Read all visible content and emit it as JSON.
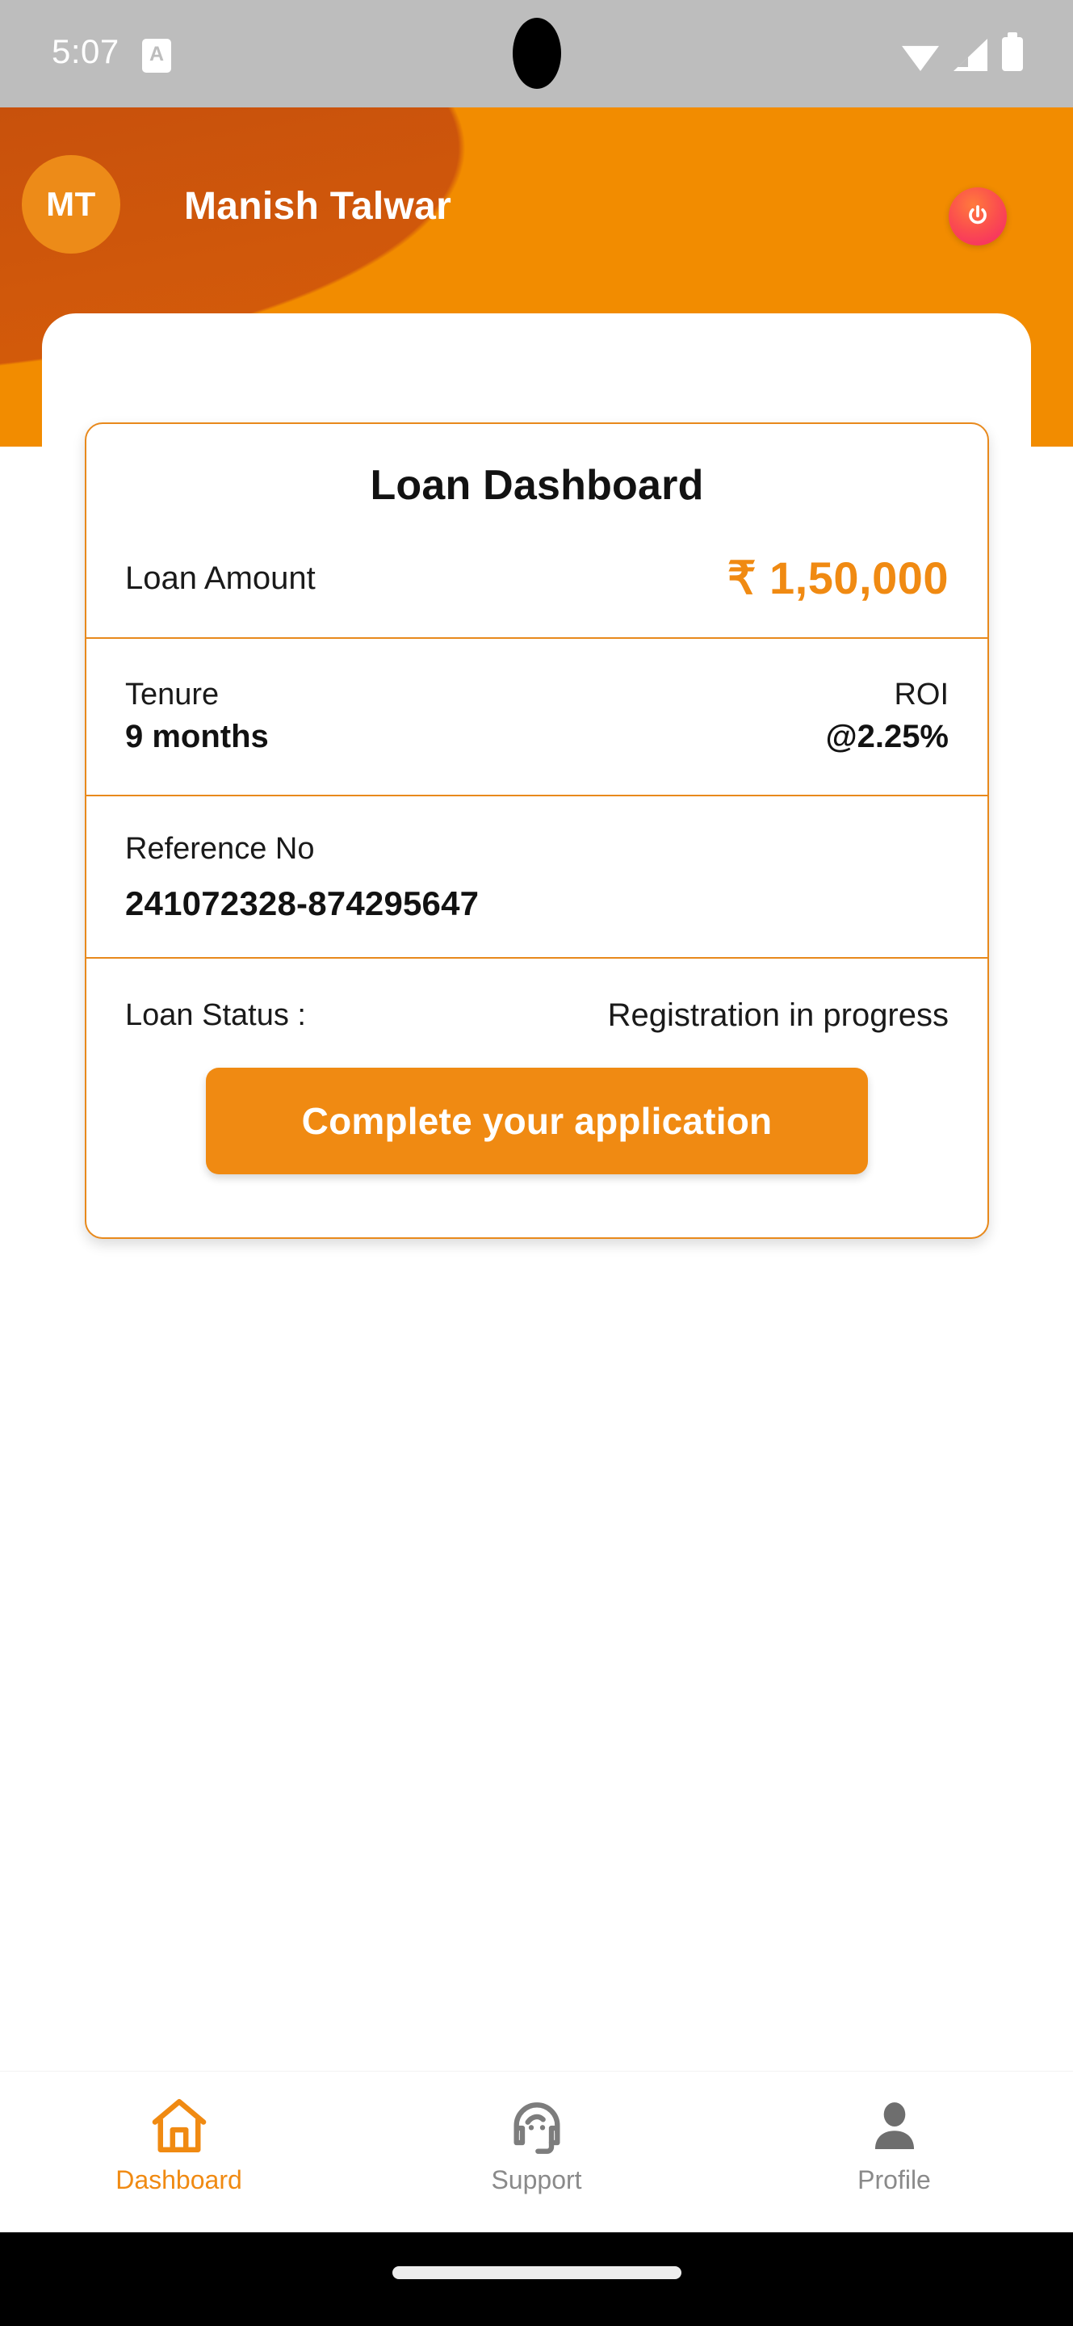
{
  "status_bar": {
    "time": "5:07",
    "app_badge": "A",
    "icons": [
      "wifi-icon",
      "cellular-signal-icon",
      "battery-icon"
    ]
  },
  "header": {
    "avatar_initials": "MT",
    "user_name": "Manish Talwar",
    "power_icon": "power-icon",
    "colors": {
      "dark_orange": "#C9520D",
      "bright_orange": "#F28C00",
      "avatar_bg": "#ED8B18",
      "power_button": "#F5256B"
    }
  },
  "card": {
    "title": "Loan Dashboard",
    "loan_amount_label": "Loan Amount",
    "loan_amount_value": "₹ 1,50,000",
    "tenure_label": "Tenure",
    "tenure_value": "9 months",
    "roi_label": "ROI",
    "roi_value": "@2.25%",
    "reference_label": "Reference No",
    "reference_value": "241072328-874295647",
    "status_label": "Loan Status :",
    "status_value": "Registration in progress",
    "cta_label": "Complete your application",
    "colors": {
      "border": "#E8891C",
      "accent": "#F08A12",
      "text": "#121212"
    }
  },
  "bottom_nav": {
    "items": [
      {
        "label": "Dashboard",
        "icon": "home-icon",
        "active": true
      },
      {
        "label": "Support",
        "icon": "headset-icon",
        "active": false
      },
      {
        "label": "Profile",
        "icon": "person-icon",
        "active": false
      }
    ],
    "active_color": "#F08A12",
    "inactive_color": "#8a8a8a"
  }
}
